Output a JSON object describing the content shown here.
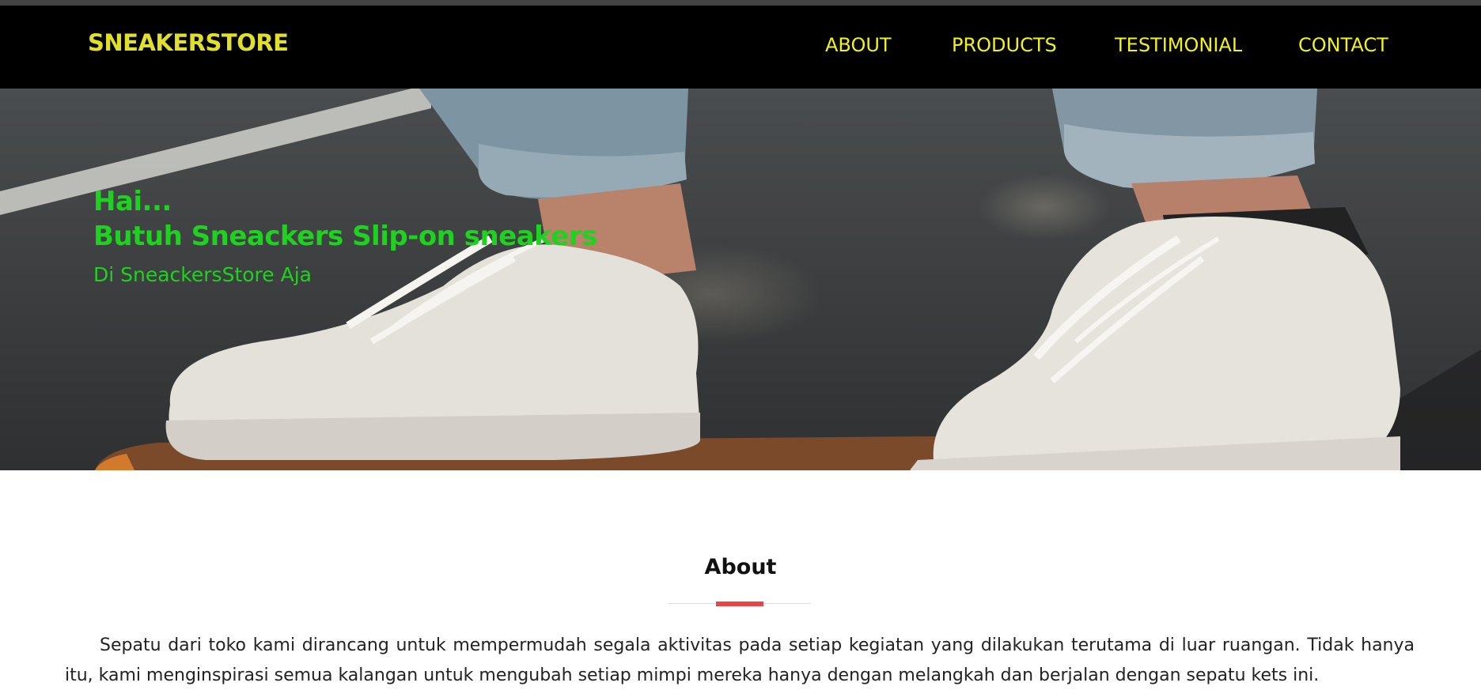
{
  "brand": "SNEAKERSTORE",
  "nav": {
    "items": [
      "ABOUT",
      "PRODUCTS",
      "TESTIMONIAL",
      "CONTACT"
    ]
  },
  "hero": {
    "greeting": "Hai...",
    "title": "Butuh Sneackers Slip-on sneakers",
    "subtitle": "Di SneackersStore Aja",
    "image_icon": "sneakers-photo"
  },
  "about": {
    "heading": "About",
    "paragraph": "Sepatu dari toko kami dirancang untuk mempermudah segala aktivitas pada setiap kegiatan yang dilakukan terutama di luar ruangan. Tidak hanya itu, kami menginspirasi semua kalangan untuk mengubah setiap mimpi mereka hanya dengan melangkah dan berjalan dengan sepatu kets ini."
  },
  "colors": {
    "navbar_bg": "#000000",
    "brand": "#e0e02a",
    "nav_link": "#f2f216",
    "hero_text": "#1fd21f",
    "accent": "#e84545"
  }
}
